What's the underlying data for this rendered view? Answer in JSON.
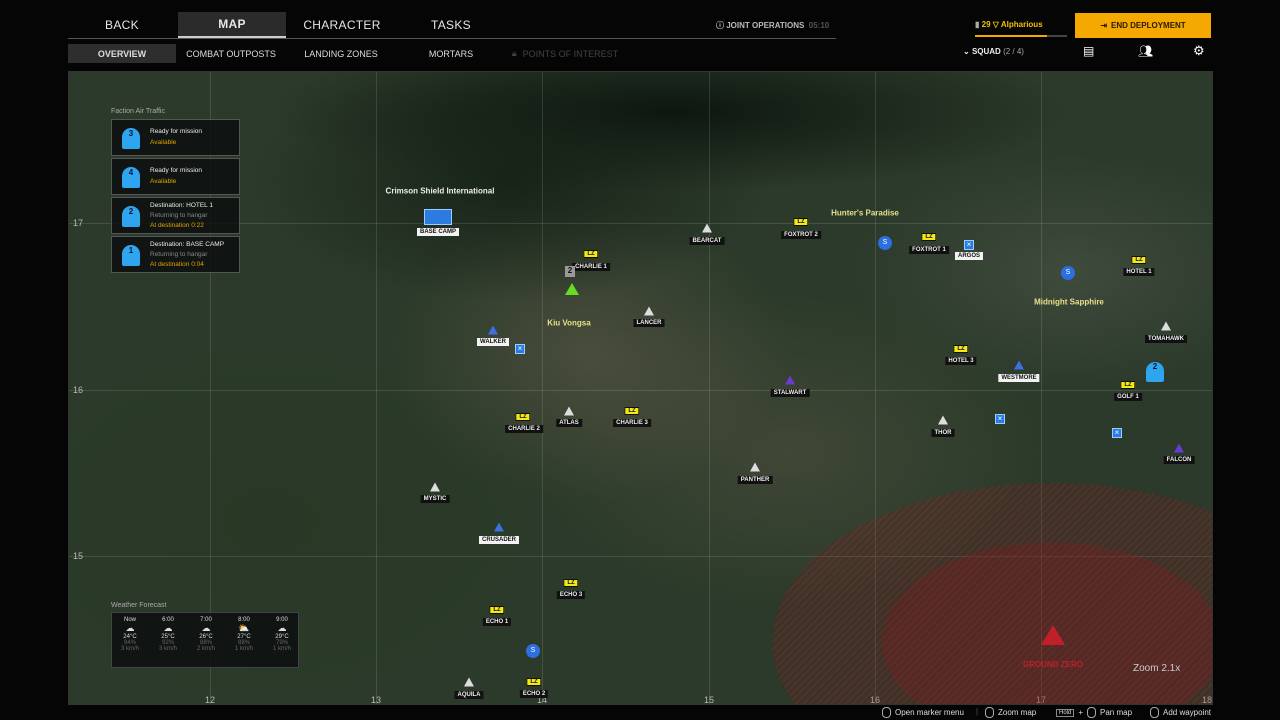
{
  "nav": {
    "tabs": [
      "BACK",
      "MAP",
      "CHARACTER",
      "TASKS"
    ],
    "active": "MAP"
  },
  "subnav": {
    "items": [
      "OVERVIEW",
      "COMBAT OUTPOSTS",
      "LANDING ZONES",
      "MORTARS",
      "POINTS OF INTEREST"
    ],
    "active": "OVERVIEW"
  },
  "mission": {
    "name": "JOINT OPERATIONS",
    "timer": "05:10"
  },
  "player": {
    "level": "29",
    "name": "Alpharious"
  },
  "end_deployment": "END DEPLOYMENT",
  "squad": {
    "label": "SQUAD",
    "count": "(2 / 4)"
  },
  "air_traffic": {
    "title": "Faction Air Traffic",
    "items": [
      {
        "num": "3",
        "title": "Ready for mission",
        "status": "Available"
      },
      {
        "num": "4",
        "title": "Ready for mission",
        "status": "Available"
      },
      {
        "num": "2",
        "title": "Destination: HOTEL 1",
        "sub": "Returning to hangar",
        "status": "At destination 0:22"
      },
      {
        "num": "1",
        "title": "Destination: BASE CAMP",
        "sub": "Returning to hangar",
        "status": "At destination 0:04"
      }
    ]
  },
  "weather": {
    "title": "Weather Forecast",
    "items": [
      {
        "time": "Now",
        "temp": "24°C",
        "hum": "94%",
        "wind": "3 km/h"
      },
      {
        "time": "6:00",
        "temp": "25°C",
        "hum": "92%",
        "wind": "3 km/h"
      },
      {
        "time": "7:00",
        "temp": "26°C",
        "hum": "88%",
        "wind": "2 km/h"
      },
      {
        "time": "8:00",
        "temp": "27°C",
        "hum": "88%",
        "wind": "1 km/h"
      },
      {
        "time": "9:00",
        "temp": "29°C",
        "hum": "79%",
        "wind": "1 km/h"
      }
    ]
  },
  "places": [
    "Crimson Shield International",
    "Hunter's Paradise",
    "Kiu Vongsa",
    "Midnight Sapphire"
  ],
  "lz_tag": "LZ",
  "markers": [
    "BASE CAMP",
    "CHARLIE 1",
    "BEARCAT",
    "FOXTROT 2",
    "FOXTROT 1",
    "ARGOS",
    "HOTEL 1",
    "LANCER",
    "WALKER",
    "STALWART",
    "HOTEL 3",
    "WESTMORE",
    "TOMAHAWK",
    "GOLF 1",
    "CHARLIE 2",
    "ATLAS",
    "CHARLIE 3",
    "THOR",
    "FALCON",
    "PANTHER",
    "MYSTIC",
    "CRUSADER",
    "ECHO 3",
    "ECHO 1",
    "ECHO 2",
    "AQUILA"
  ],
  "squad_marker": "2",
  "aircraft_on_map": "2",
  "pin_letter": "S",
  "grid": {
    "rows": [
      "17",
      "16",
      "15"
    ],
    "cols": [
      "12",
      "13",
      "14",
      "15",
      "16",
      "17",
      "18"
    ]
  },
  "ground_zero": "GROUND ZERO",
  "zoom": "Zoom 2.1x",
  "hints": {
    "marker": "Open marker menu",
    "zoom": "Zoom map",
    "hold": "Hold",
    "pan": "Pan map",
    "waypoint": "Add waypoint"
  },
  "colors": {
    "accent": "#f5a800",
    "lz": "#f2ea16",
    "danger": "#c0202a",
    "air": "#2ea6ef"
  }
}
